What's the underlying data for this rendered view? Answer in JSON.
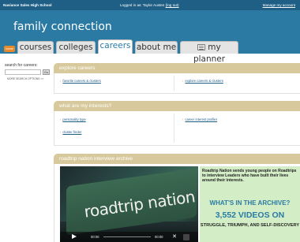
{
  "topbar": {
    "school": "Naviance Sales High School",
    "logged_in_prefix": "Logged in as: Taylor Austen",
    "logout": "(log out)",
    "account": "Manage my account"
  },
  "header": {
    "brand": "family connection"
  },
  "nav": {
    "home": "home",
    "tabs": [
      {
        "label": "courses"
      },
      {
        "label": "colleges"
      },
      {
        "label": "careers",
        "active": true
      },
      {
        "label": "about me"
      },
      {
        "label": "my planner"
      }
    ]
  },
  "sidebar": {
    "label": "search for careers:",
    "search_value": "",
    "go": "Go",
    "more": "MORE SEARCH OPTIONS >>"
  },
  "explore": {
    "title": "explore careers",
    "link1": "favorite careers & clusters",
    "link2": "explore careers & clusters"
  },
  "interests": {
    "title": "what are my interests?",
    "link1": "personality type",
    "link2": "career interest profiler",
    "link3": "cluster finder"
  },
  "archive": {
    "title": "roadtrip nation interview archive",
    "video_logo": "roadtrip nation",
    "time_current": "00:00",
    "time_total": "00:00"
  },
  "promo": {
    "text": "Roadtrip Nation sends young people on Roadtrips to interview Leaders who have built their lives around their interests.",
    "headline": "WHAT'S IN THE ARCHIVE?",
    "count": "3,552 VIDEOS ON",
    "topics": "STRUGGLE, TRIUMPH, AND SELF-DISCOVERY"
  },
  "colors": {
    "topbar": "#1f5f86",
    "header": "#2a7aa4",
    "panel_head": "#d8c99d",
    "accent": "#e58a2a",
    "promo_bg": "#d3eec6"
  }
}
